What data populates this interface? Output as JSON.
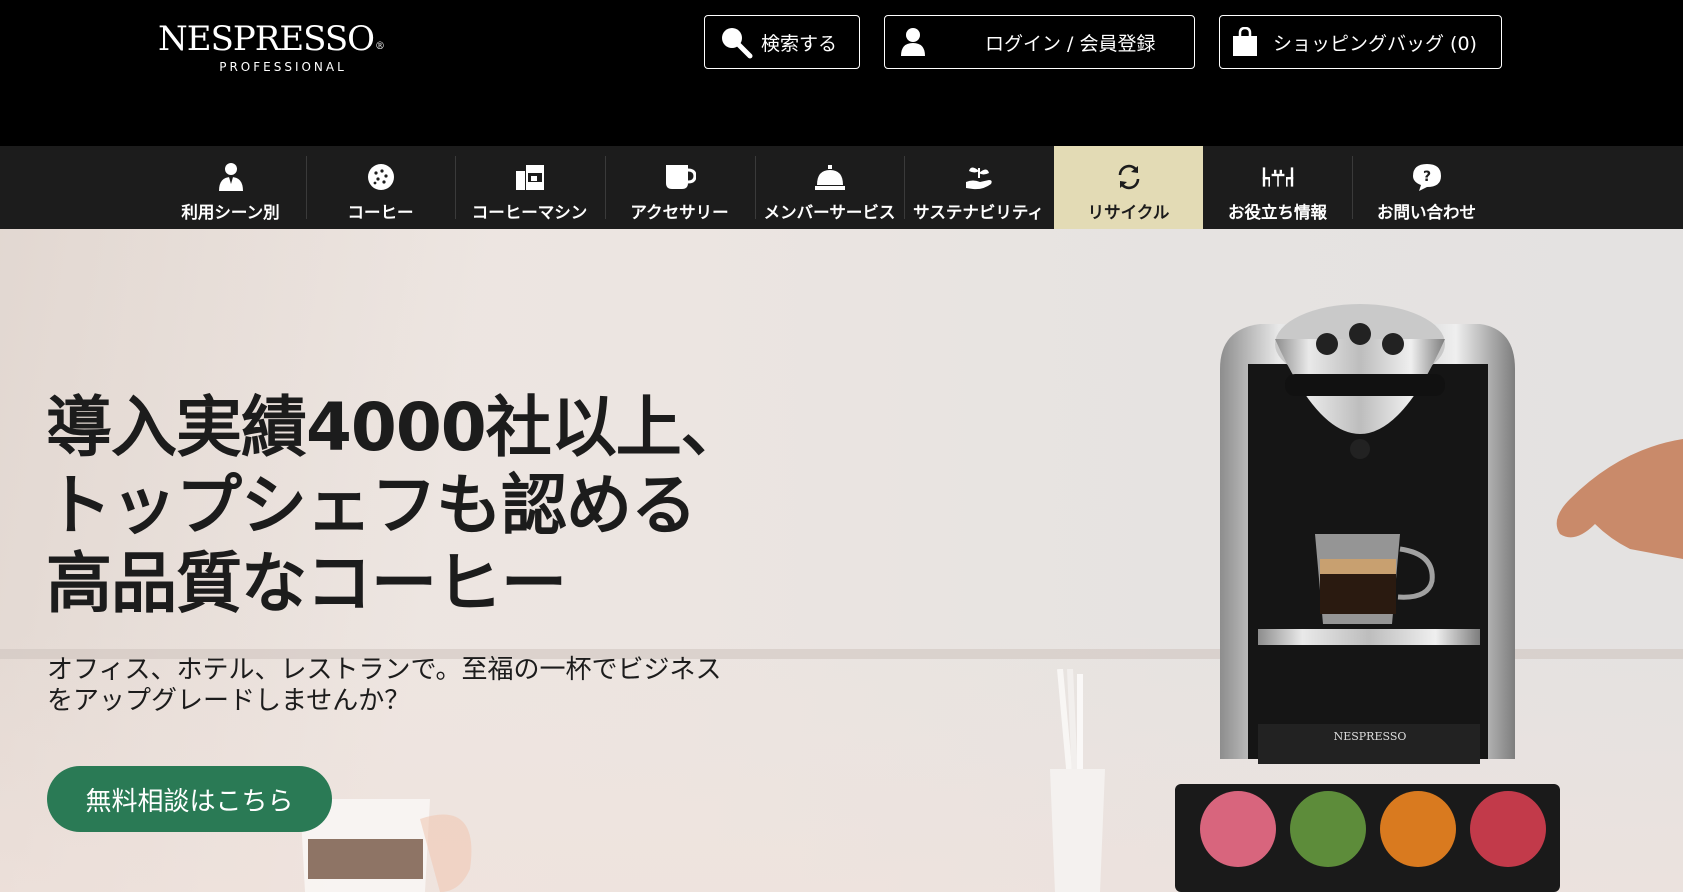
{
  "header": {
    "logo_main": "NESPRESSO",
    "logo_reg": "®",
    "logo_sub": "PROFESSIONAL",
    "search_label": "検索する",
    "login_label": "ログイン / 会員登録",
    "bag_label": "ショッピングバッグ (0)"
  },
  "nav": {
    "items": [
      {
        "label": "利用シーン別",
        "icon": "waiter-icon"
      },
      {
        "label": "コーヒー",
        "icon": "capsule-icon"
      },
      {
        "label": "コーヒーマシン",
        "icon": "machine-icon"
      },
      {
        "label": "アクセサリー",
        "icon": "cup-icon"
      },
      {
        "label": "メンバーサービス",
        "icon": "service-bell-icon"
      },
      {
        "label": "サステナビリティ",
        "icon": "plant-hand-icon"
      },
      {
        "label": "リサイクル",
        "icon": "recycle-icon",
        "active": true
      },
      {
        "label": "お役立ち情報",
        "icon": "table-chairs-icon"
      },
      {
        "label": "お問い合わせ",
        "icon": "question-icon"
      }
    ]
  },
  "hero": {
    "title_line1": "導入実績4000社以上、",
    "title_line2": "トップシェフも認める",
    "title_line3": "高品質なコーヒー",
    "subtitle_line1": "オフィス、ホテル、レストランで。至福の一杯でビジネス",
    "subtitle_line2": "をアップグレードしませんか？",
    "cta_label": "無料相談はこちら",
    "machine_brand": "NESPRESSO"
  },
  "colors": {
    "header_bg": "#000000",
    "nav_bg": "#1c1c1c",
    "nav_active_bg": "#e3dbb5",
    "cta_green": "#2a7a55",
    "text_dark": "#1c1c1c"
  }
}
